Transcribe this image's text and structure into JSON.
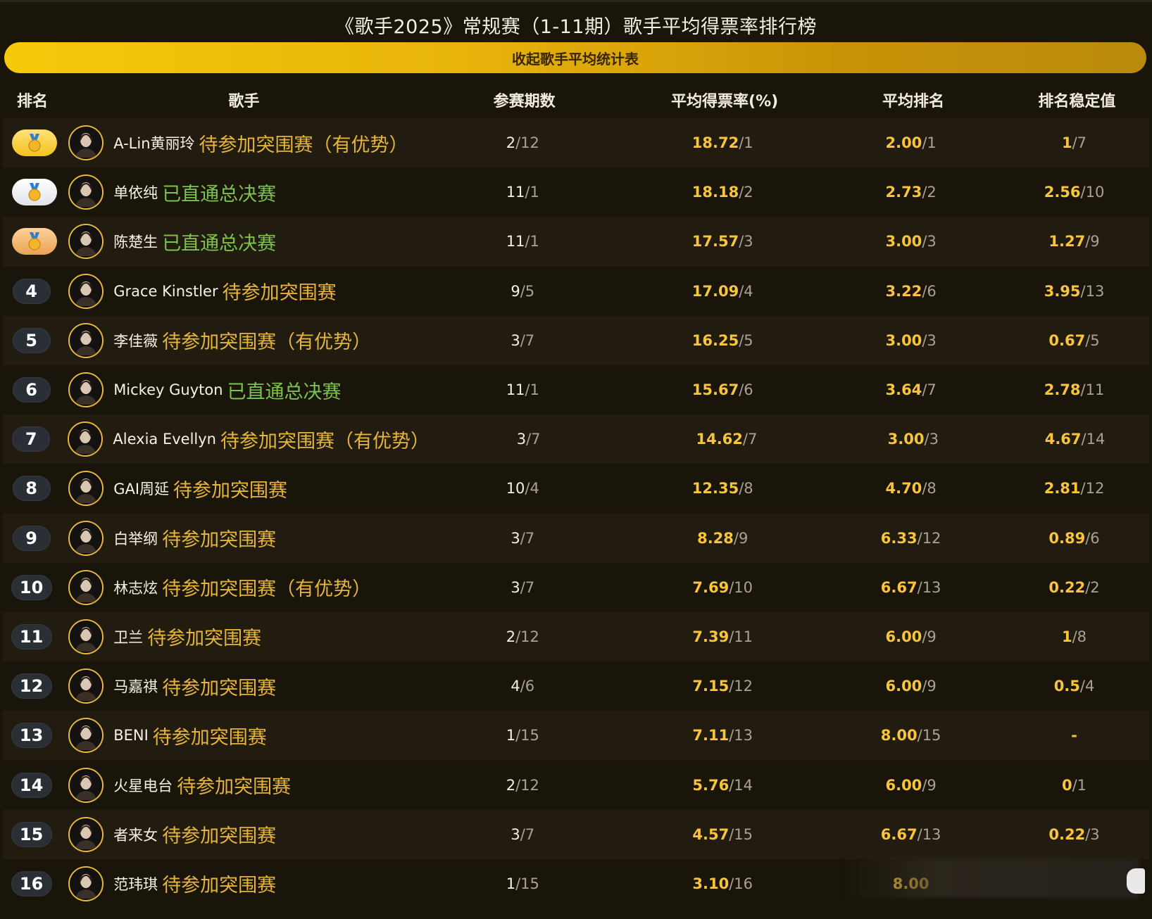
{
  "title": "《歌手2025》常规赛（1-11期）歌手平均得票率排行榜",
  "collapse_label": "收起歌手平均统计表",
  "headers": {
    "rank": "排名",
    "singer": "歌手",
    "sessions": "参赛期数",
    "rate": "平均得票率(%)",
    "avg_rank": "平均排名",
    "stability": "排名稳定值"
  },
  "colors": {
    "accent": "#f7c43b",
    "green_status": "#7cc24e",
    "yellow_status": "#e5b43a"
  },
  "rows": [
    {
      "rank": "1",
      "medal": "gold",
      "name": "A-Lin黄丽玲",
      "status": "待参加突围赛（有优势）",
      "status_color": "yellow",
      "sessions": "2",
      "sessions_rank": "/12",
      "rate": "18.72",
      "rate_rank": "/1",
      "avg": "2.00",
      "avg_rank": "/1",
      "stab": "1",
      "stab_rank": "/7"
    },
    {
      "rank": "2",
      "medal": "silver",
      "name": "单依纯",
      "status": "已直通总决赛",
      "status_color": "green",
      "sessions": "11",
      "sessions_rank": "/1",
      "rate": "18.18",
      "rate_rank": "/2",
      "avg": "2.73",
      "avg_rank": "/2",
      "stab": "2.56",
      "stab_rank": "/10"
    },
    {
      "rank": "3",
      "medal": "bronze",
      "name": "陈楚生",
      "status": "已直通总决赛",
      "status_color": "green",
      "sessions": "11",
      "sessions_rank": "/1",
      "rate": "17.57",
      "rate_rank": "/3",
      "avg": "3.00",
      "avg_rank": "/3",
      "stab": "1.27",
      "stab_rank": "/9"
    },
    {
      "rank": "4",
      "medal": "",
      "name": "Grace Kinstler",
      "status": "待参加突围赛",
      "status_color": "yellow",
      "sessions": "9",
      "sessions_rank": "/5",
      "rate": "17.09",
      "rate_rank": "/4",
      "avg": "3.22",
      "avg_rank": "/6",
      "stab": "3.95",
      "stab_rank": "/13"
    },
    {
      "rank": "5",
      "medal": "",
      "name": "李佳薇",
      "status": "待参加突围赛（有优势）",
      "status_color": "yellow",
      "sessions": "3",
      "sessions_rank": "/7",
      "rate": "16.25",
      "rate_rank": "/5",
      "avg": "3.00",
      "avg_rank": "/3",
      "stab": "0.67",
      "stab_rank": "/5"
    },
    {
      "rank": "6",
      "medal": "",
      "name": "Mickey Guyton",
      "status": "已直通总决赛",
      "status_color": "green",
      "sessions": "11",
      "sessions_rank": "/1",
      "rate": "15.67",
      "rate_rank": "/6",
      "avg": "3.64",
      "avg_rank": "/7",
      "stab": "2.78",
      "stab_rank": "/11"
    },
    {
      "rank": "7",
      "medal": "",
      "name": "Alexia Evellyn",
      "status": "待参加突围赛（有优势）",
      "status_color": "yellow",
      "sessions": "3",
      "sessions_rank": "/7",
      "rate": "14.62",
      "rate_rank": "/7",
      "avg": "3.00",
      "avg_rank": "/3",
      "stab": "4.67",
      "stab_rank": "/14"
    },
    {
      "rank": "8",
      "medal": "",
      "name": "GAI周延",
      "status": "待参加突围赛",
      "status_color": "yellow",
      "sessions": "10",
      "sessions_rank": "/4",
      "rate": "12.35",
      "rate_rank": "/8",
      "avg": "4.70",
      "avg_rank": "/8",
      "stab": "2.81",
      "stab_rank": "/12"
    },
    {
      "rank": "9",
      "medal": "",
      "name": "白举纲",
      "status": "待参加突围赛",
      "status_color": "yellow",
      "sessions": "3",
      "sessions_rank": "/7",
      "rate": "8.28",
      "rate_rank": "/9",
      "avg": "6.33",
      "avg_rank": "/12",
      "stab": "0.89",
      "stab_rank": "/6"
    },
    {
      "rank": "10",
      "medal": "",
      "name": "林志炫",
      "status": "待参加突围赛（有优势）",
      "status_color": "yellow",
      "sessions": "3",
      "sessions_rank": "/7",
      "rate": "7.69",
      "rate_rank": "/10",
      "avg": "6.67",
      "avg_rank": "/13",
      "stab": "0.22",
      "stab_rank": "/2"
    },
    {
      "rank": "11",
      "medal": "",
      "name": "卫兰",
      "status": "待参加突围赛",
      "status_color": "yellow",
      "sessions": "2",
      "sessions_rank": "/12",
      "rate": "7.39",
      "rate_rank": "/11",
      "avg": "6.00",
      "avg_rank": "/9",
      "stab": "1",
      "stab_rank": "/8"
    },
    {
      "rank": "12",
      "medal": "",
      "name": "马嘉祺",
      "status": "待参加突围赛",
      "status_color": "yellow",
      "sessions": "4",
      "sessions_rank": "/6",
      "rate": "7.15",
      "rate_rank": "/12",
      "avg": "6.00",
      "avg_rank": "/9",
      "stab": "0.5",
      "stab_rank": "/4"
    },
    {
      "rank": "13",
      "medal": "",
      "name": "BENI",
      "status": "待参加突围赛",
      "status_color": "yellow",
      "sessions": "1",
      "sessions_rank": "/15",
      "rate": "7.11",
      "rate_rank": "/13",
      "avg": "8.00",
      "avg_rank": "/15",
      "stab": "-",
      "stab_rank": ""
    },
    {
      "rank": "14",
      "medal": "",
      "name": "火星电台",
      "status": "待参加突围赛",
      "status_color": "yellow",
      "sessions": "2",
      "sessions_rank": "/12",
      "rate": "5.76",
      "rate_rank": "/14",
      "avg": "6.00",
      "avg_rank": "/9",
      "stab": "0",
      "stab_rank": "/1"
    },
    {
      "rank": "15",
      "medal": "",
      "name": "者来女",
      "status": "待参加突围赛",
      "status_color": "yellow",
      "sessions": "3",
      "sessions_rank": "/7",
      "rate": "4.57",
      "rate_rank": "/15",
      "avg": "6.67",
      "avg_rank": "/13",
      "stab": "0.22",
      "stab_rank": "/3"
    },
    {
      "rank": "16",
      "medal": "",
      "name": "范玮琪",
      "status": "待参加突围赛",
      "status_color": "yellow",
      "sessions": "1",
      "sessions_rank": "/15",
      "rate": "3.10",
      "rate_rank": "/16",
      "avg": "8.00",
      "avg_rank": "",
      "stab": "",
      "stab_rank": ""
    }
  ]
}
